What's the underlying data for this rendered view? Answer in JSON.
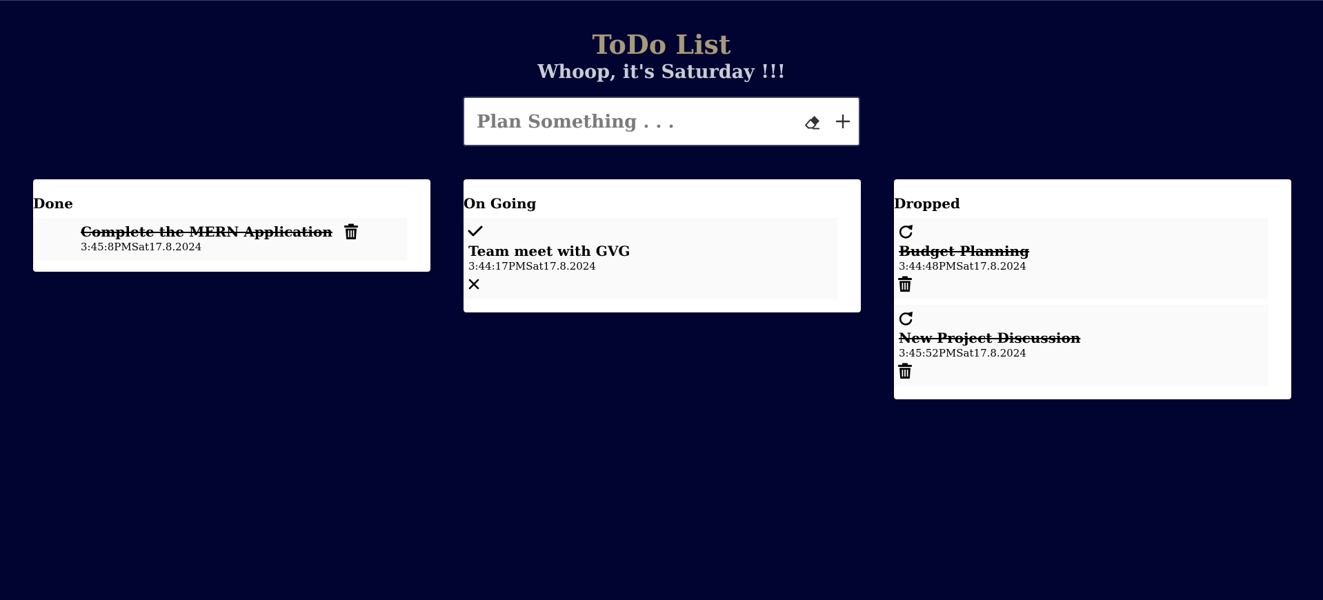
{
  "header": {
    "title": "ToDo List",
    "subtitle": "Whoop, it's Saturday !!!"
  },
  "input": {
    "placeholder": "Plan Something . . .",
    "value": "",
    "clear_icon": "eraser-icon",
    "add_icon": "plus-icon"
  },
  "columns": {
    "done": {
      "title": "Done",
      "tasks": [
        {
          "text": "Complete the MERN Application",
          "time": "3:45:8PMSat17.8.2024"
        }
      ]
    },
    "ongoing": {
      "title": "On Going",
      "tasks": [
        {
          "text": "Team meet with GVG",
          "time": "3:44:17PMSat17.8.2024"
        }
      ]
    },
    "dropped": {
      "title": "Dropped",
      "tasks": [
        {
          "text": "Budget Planning",
          "time": "3:44:48PMSat17.8.2024"
        },
        {
          "text": "New Project Discussion",
          "time": "3:45:52PMSat17.8.2024"
        }
      ]
    }
  },
  "icons": {
    "done_action": "trash-icon",
    "ongoing_complete": "check-icon",
    "ongoing_drop": "close-icon",
    "dropped_restore": "redo-icon",
    "dropped_delete": "trash-icon"
  },
  "colors": {
    "background": "#010331",
    "title": "#a8997a",
    "subtitle": "#c9ccd3",
    "card": "#ffffff",
    "task_bg": "#fafafa"
  }
}
